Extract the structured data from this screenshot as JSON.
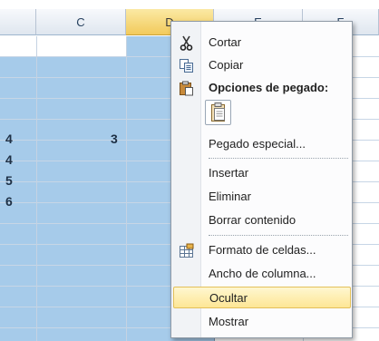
{
  "sheet": {
    "columns": [
      "",
      "C",
      "D",
      "E",
      "F"
    ],
    "selected_column": "D",
    "cell_values": {
      "row5_colB": "4",
      "row5_colC": "3",
      "row6_colB": "4",
      "row7_colB": "5",
      "row8_colB": "6"
    }
  },
  "menu": {
    "cut": "Cortar",
    "copy": "Copiar",
    "paste_options_header": "Opciones de pegado:",
    "paste_special": "Pegado especial...",
    "insert": "Insertar",
    "delete": "Eliminar",
    "clear_contents": "Borrar contenido",
    "format_cells": "Formato de celdas...",
    "column_width": "Ancho de columna...",
    "hide": "Ocultar",
    "unhide": "Mostrar"
  },
  "icons": {
    "cut": "scissors-icon",
    "copy": "copy-icon",
    "paste_header": "clipboard-icon",
    "paste_option": "paste-icon",
    "format_cells": "format-cells-icon"
  },
  "colors": {
    "selection": "#a6cbea",
    "selected_header": "#f2ca5b",
    "menu_hover": "#fde695"
  }
}
